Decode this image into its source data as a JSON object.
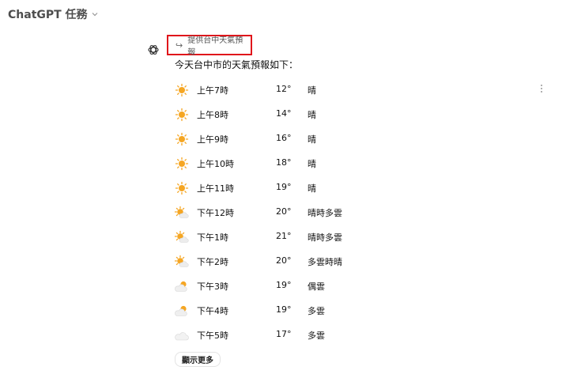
{
  "header": {
    "title": "ChatGPT 任務",
    "dropdown_icon": "chevron-down-icon"
  },
  "message": {
    "avatar_icon": "openai-logo-icon",
    "task_chip": {
      "arrow": "↪",
      "label": "提供台中天氣預報"
    },
    "intro": "今天台中市的天氣預報如下：",
    "more_options_icon": "vertical-ellipsis-icon"
  },
  "forecast": [
    {
      "icon": "sun-icon",
      "time": "上午7時",
      "temp": "12°",
      "condition": "晴"
    },
    {
      "icon": "sun-icon",
      "time": "上午8時",
      "temp": "14°",
      "condition": "晴"
    },
    {
      "icon": "sun-icon",
      "time": "上午9時",
      "temp": "16°",
      "condition": "晴"
    },
    {
      "icon": "sun-icon",
      "time": "上午10時",
      "temp": "18°",
      "condition": "晴"
    },
    {
      "icon": "sun-icon",
      "time": "上午11時",
      "temp": "19°",
      "condition": "晴"
    },
    {
      "icon": "sun-cloud-icon",
      "time": "下午12時",
      "temp": "20°",
      "condition": "晴時多雲"
    },
    {
      "icon": "sun-cloud-icon",
      "time": "下午1時",
      "temp": "21°",
      "condition": "晴時多雲"
    },
    {
      "icon": "sun-cloud-icon",
      "time": "下午2時",
      "temp": "20°",
      "condition": "多雲時晴"
    },
    {
      "icon": "cloud-sun-icon",
      "time": "下午3時",
      "temp": "19°",
      "condition": "偶雲"
    },
    {
      "icon": "cloud-sun-icon",
      "time": "下午4時",
      "temp": "19°",
      "condition": "多雲"
    },
    {
      "icon": "cloud-icon",
      "time": "下午5時",
      "temp": "17°",
      "condition": "多雲"
    }
  ],
  "show_more_label": "顯示更多",
  "colors": {
    "sun": "#f5a623",
    "cloud": "#e6e6e6",
    "highlight_border": "#e0161b"
  }
}
